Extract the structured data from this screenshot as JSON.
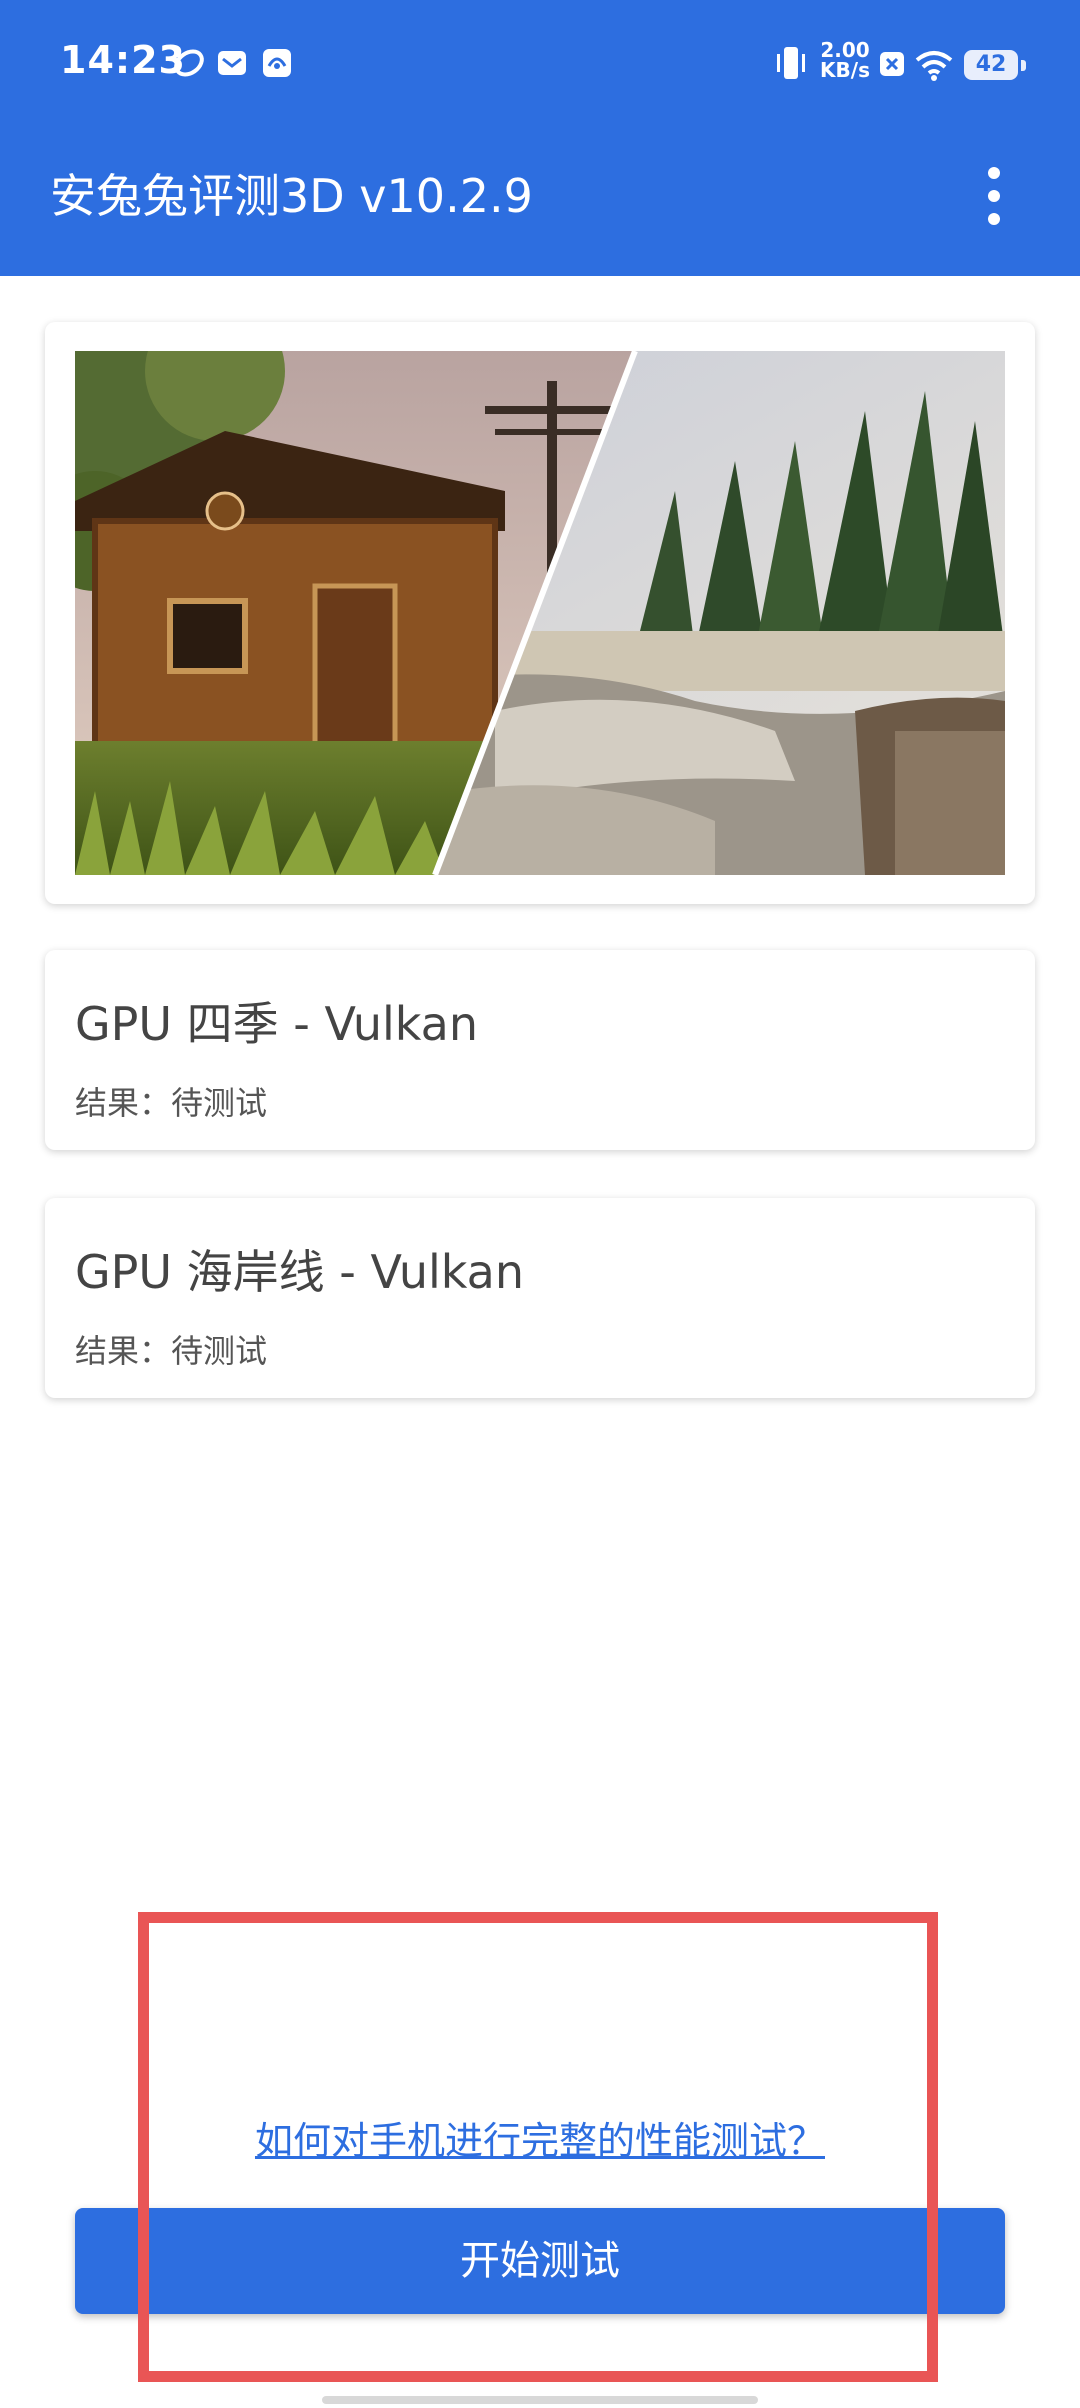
{
  "status_bar": {
    "time": "14:23",
    "network_speed_value": "2.00",
    "network_speed_unit": "KB/s",
    "battery": "42"
  },
  "header": {
    "title": "安兔兔评测3D v10.2.9"
  },
  "benchmarks": [
    {
      "name": "GPU 四季 - Vulkan",
      "result_label": "结果：",
      "result_value": "待测试"
    },
    {
      "name": "GPU 海岸线 - Vulkan",
      "result_label": "结果：",
      "result_value": "待测试"
    }
  ],
  "footer": {
    "help_link": "如何对手机进行完整的性能测试？",
    "start_button": "开始测试"
  },
  "colors": {
    "primary": "#2d6ee0",
    "highlight": "#e95555"
  }
}
